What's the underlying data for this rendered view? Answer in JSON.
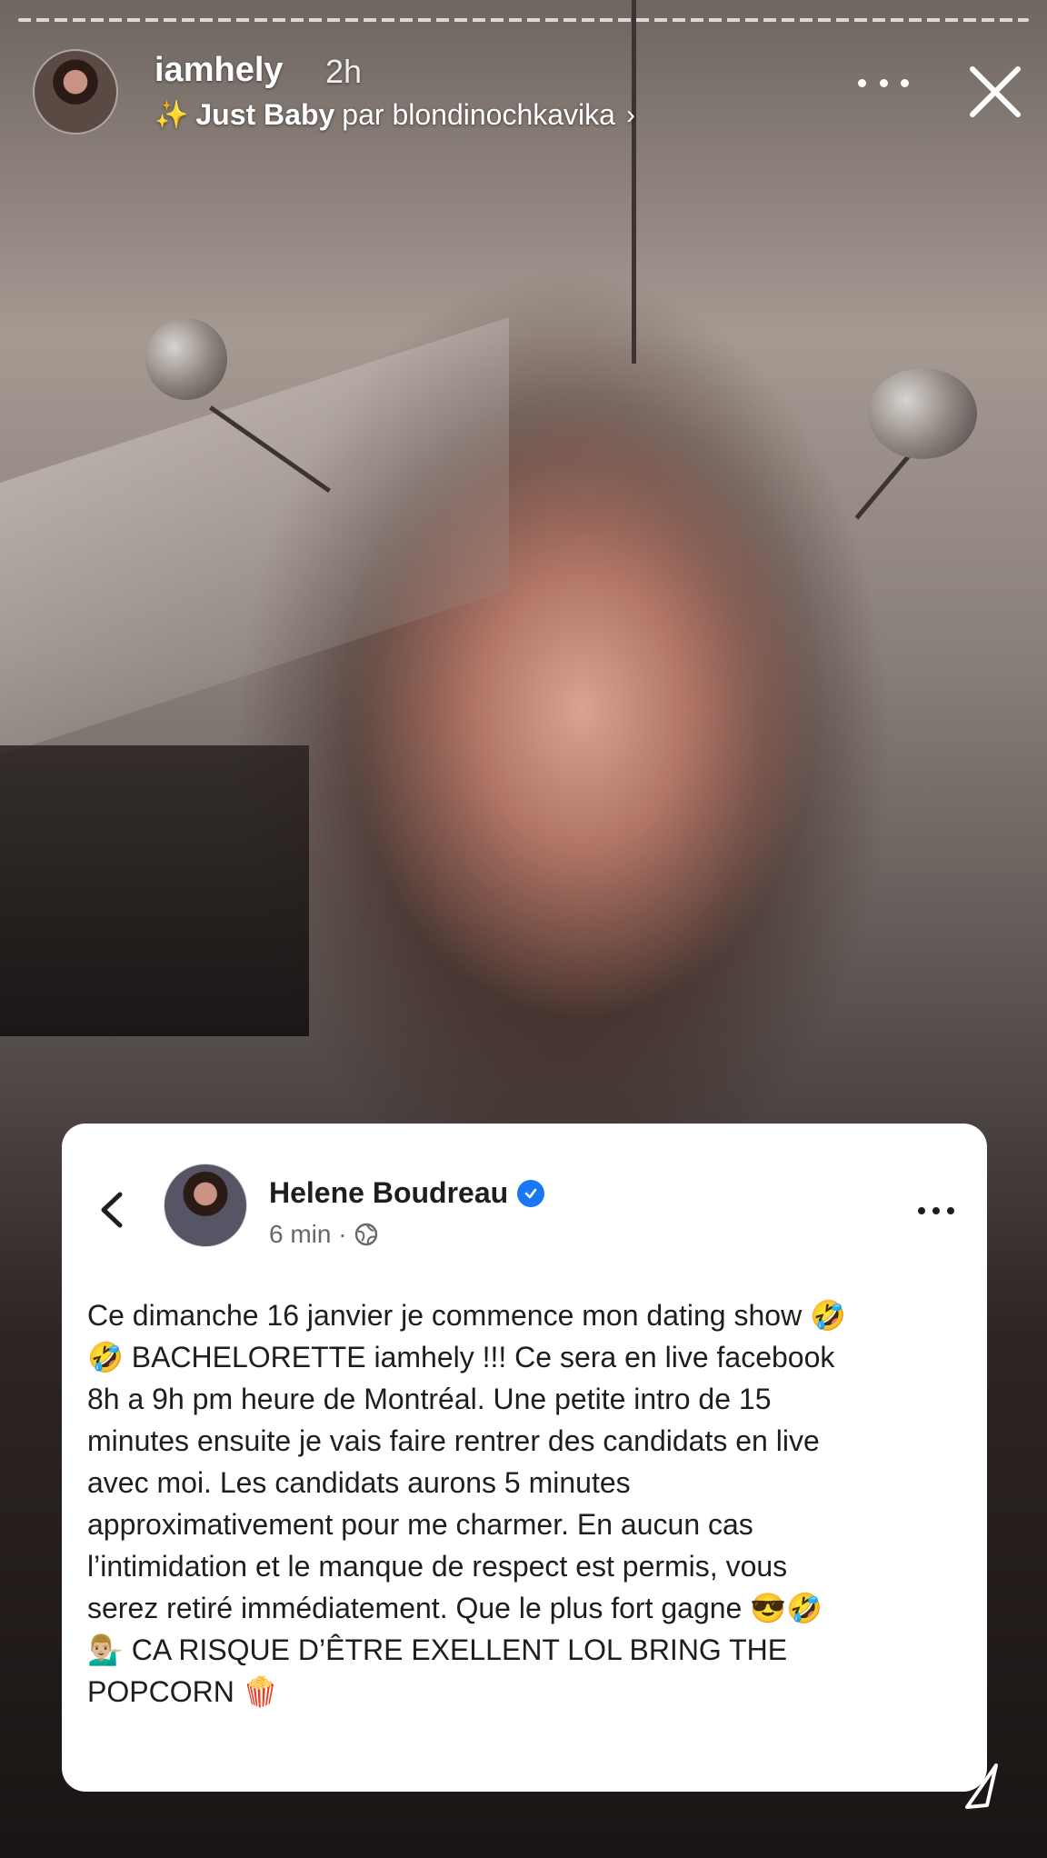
{
  "story": {
    "username": "iamhely",
    "time": "2h",
    "music_icon": "sparkle-icon",
    "music_title": "Just Baby",
    "music_by": "par blondinochkavika",
    "music_chevron": "›"
  },
  "post": {
    "author": "Helene Boudreau",
    "meta": "6 min ·",
    "lines": [
      "Ce dimanche 16 janvier je commence mon dating show 🤣",
      "🤣 BACHELORETTE iamhely !!! Ce sera en live facebook",
      "8h a 9h pm heure de Montréal. Une petite intro de 15",
      "minutes ensuite je vais faire rentrer des candidats en live",
      "avec moi. Les candidats aurons 5 minutes",
      "approximativement pour me charmer. En aucun cas",
      "l’intimidation et le manque de respect est permis, vous",
      "serez retiré immédiatement. Que le plus fort gagne 😎🤣",
      "💁🏼‍♂️ CA RISQUE D’ÊTRE EXELLENT LOL BRING THE",
      "POPCORN 🍿"
    ]
  },
  "colors": {
    "verified": "#1877f2",
    "text": "#1c1e21",
    "meta": "#65676b"
  }
}
